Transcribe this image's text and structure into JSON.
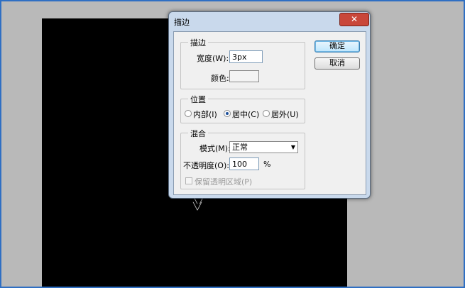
{
  "dialog": {
    "title": "描边",
    "stroke_group": {
      "legend": "描边",
      "width_label": "宽度(W):",
      "width_value": "3px",
      "color_label": "颜色:"
    },
    "position_group": {
      "legend": "位置",
      "options": [
        {
          "label": "内部(I)",
          "checked": false
        },
        {
          "label": "居中(C)",
          "checked": true
        },
        {
          "label": "居外(U)",
          "checked": false
        }
      ]
    },
    "blend_group": {
      "legend": "混合",
      "mode_label": "模式(M):",
      "mode_value": "正常",
      "opacity_label": "不透明度(O):",
      "opacity_value": "100",
      "opacity_unit": "%",
      "preserve_label": "保留透明区域(P)"
    },
    "buttons": {
      "ok": "确定",
      "cancel": "取消"
    }
  },
  "colors": {
    "canvas": "#000000",
    "workspace": "#b9b9b9",
    "frame": "#2f6fc3"
  }
}
